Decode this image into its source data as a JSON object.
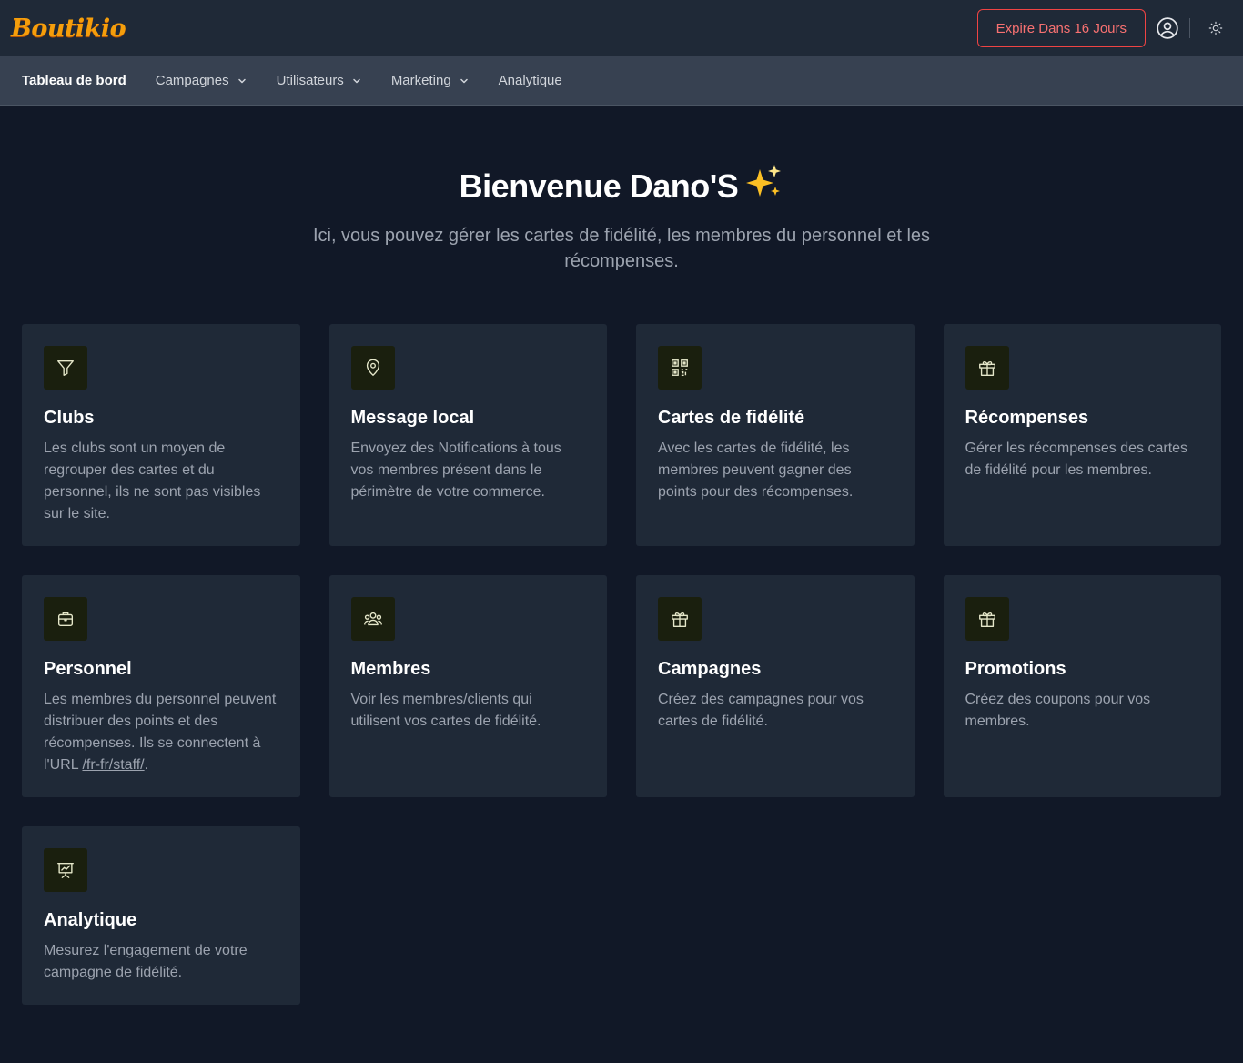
{
  "header": {
    "logo_text": "Boutikio",
    "expire_label": "Expire Dans 16 Jours",
    "user_icon": "user-circle-icon",
    "theme_icon": "sun-icon"
  },
  "nav": {
    "items": [
      {
        "label": "Tableau de bord",
        "dropdown": false
      },
      {
        "label": "Campagnes",
        "dropdown": true
      },
      {
        "label": "Utilisateurs",
        "dropdown": true
      },
      {
        "label": "Marketing",
        "dropdown": true
      },
      {
        "label": "Analytique",
        "dropdown": false
      }
    ]
  },
  "hero": {
    "title": "Bienvenue Dano'S",
    "subtitle": "Ici, vous pouvez gérer les cartes de fidélité, les membres du personnel et les récompenses."
  },
  "cards": [
    {
      "title": "Clubs",
      "text": "Les clubs sont un moyen de regrouper des cartes et du personnel, ils ne sont pas visibles sur le site.",
      "icon": "funnel-icon"
    },
    {
      "title": "Message local",
      "text": "Envoyez des Notifications à tous vos membres présent dans le périmètre de votre commerce.",
      "icon": "map-pin-icon"
    },
    {
      "title": "Cartes de fidélité",
      "text": "Avec les cartes de fidélité, les membres peuvent gagner des points pour des récompenses.",
      "icon": "qr-code-icon"
    },
    {
      "title": "Récompenses",
      "text": "Gérer les récompenses des cartes de fidélité pour les membres.",
      "icon": "gift-icon"
    },
    {
      "title": "Personnel",
      "text_before": "Les membres du personnel peuvent distribuer des points et des récompenses. Ils se connectent à l'URL ",
      "link": "/fr-fr/staff/",
      "text_after": ".",
      "icon": "briefcase-icon"
    },
    {
      "title": "Membres",
      "text": "Voir les membres/clients qui utilisent vos cartes de fidélité.",
      "icon": "users-icon"
    },
    {
      "title": "Campagnes",
      "text": "Créez des campagnes pour vos cartes de fidélité.",
      "icon": "gift-icon"
    },
    {
      "title": "Promotions",
      "text": "Créez des coupons pour vos membres.",
      "icon": "gift-icon"
    },
    {
      "title": "Analytique",
      "text": "Mesurez l'engagement de votre campagne de fidélité.",
      "icon": "presentation-chart-icon"
    }
  ],
  "colors": {
    "accent": "#f59e0b",
    "expire": "#f87171",
    "icon_stroke": "#e5e7c9",
    "background": "#111827",
    "card": "#1f2937"
  }
}
